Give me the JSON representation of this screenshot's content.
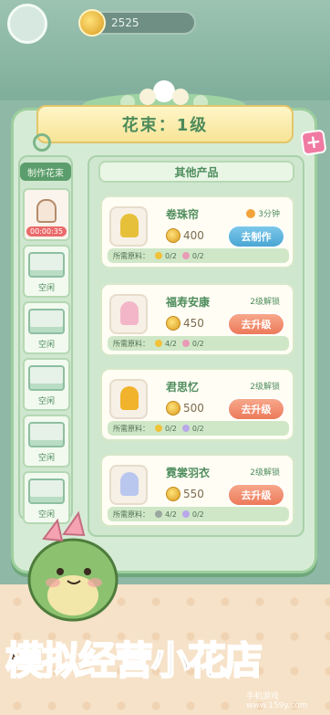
{
  "top_bar": {
    "coins": "2525"
  },
  "header": {
    "title": "花束：1级",
    "close_icon": "plus-close-icon"
  },
  "slots": {
    "title": "制作花束",
    "items": [
      {
        "state": "active",
        "timer": "00:00:35"
      },
      {
        "state": "idle",
        "label": "空闲"
      },
      {
        "state": "idle",
        "label": "空闲"
      },
      {
        "state": "idle",
        "label": "空闲"
      },
      {
        "state": "idle",
        "label": "空闲"
      },
      {
        "state": "idle",
        "label": "空闲"
      }
    ]
  },
  "list": {
    "header": "其他产品",
    "products": [
      {
        "name": "卷珠帘",
        "time": "3分钟",
        "price": "400",
        "button": "去制作",
        "button_type": "make",
        "materials_label": "所需原料：",
        "mat1": "0/2",
        "mat2": "0/2",
        "bouquet_color": "#e7c03a"
      },
      {
        "name": "福寿安康",
        "lock": "2级解锁",
        "price": "450",
        "button": "去升级",
        "button_type": "upgrade",
        "materials_label": "所需原料：",
        "mat1": "4/2",
        "mat2": "0/2",
        "bouquet_color": "#f3b6c8"
      },
      {
        "name": "君思忆",
        "lock": "2级解锁",
        "price": "500",
        "button": "去升级",
        "button_type": "upgrade",
        "materials_label": "所需原料：",
        "mat1": "0/2",
        "mat2": "0/2",
        "bouquet_color": "#f0b32b"
      },
      {
        "name": "霓裳羽衣",
        "lock": "2级解锁",
        "price": "550",
        "button": "去升级",
        "button_type": "upgrade",
        "materials_label": "所需原料：",
        "mat1": "4/2",
        "mat2": "0/2",
        "bouquet_color": "#b9c7ef"
      }
    ]
  },
  "banner": {
    "part1": "模拟",
    "part2": "经营",
    "part3": "小花店"
  },
  "watermark": "手机游戏 www.159y.com"
}
